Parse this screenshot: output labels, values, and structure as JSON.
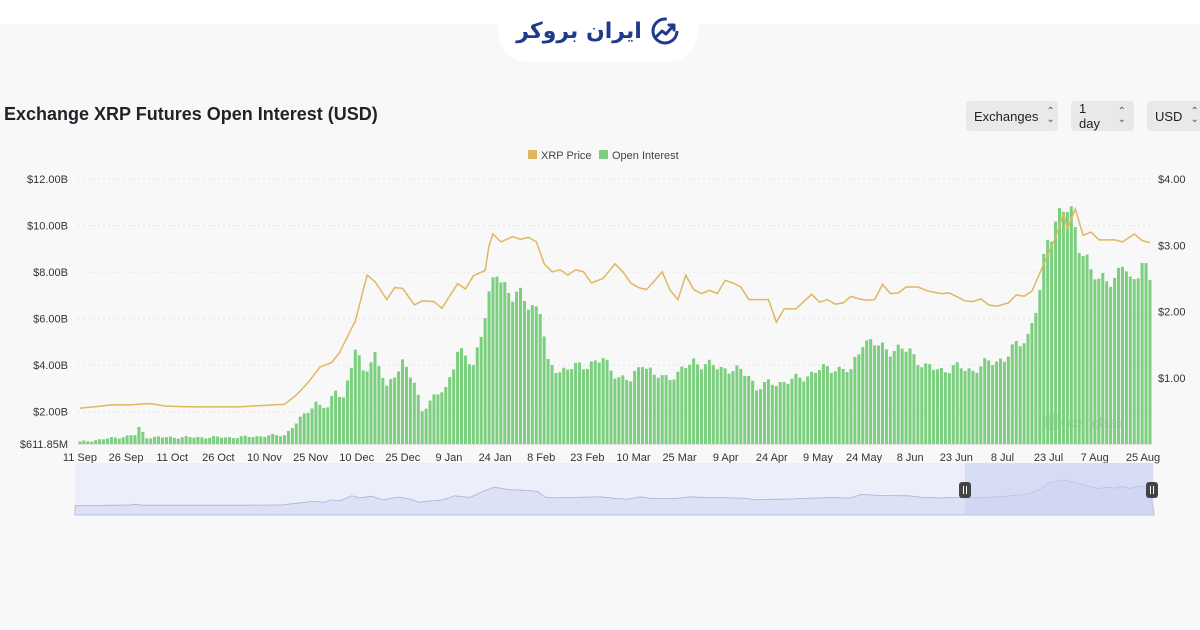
{
  "brand": {
    "name": "ایران بروکر"
  },
  "title": "Exchange XRP Futures Open Interest (USD)",
  "controls": {
    "exchanges": "Exchanges",
    "interval": "1 day",
    "currency": "USD"
  },
  "watermark": "coinglass",
  "colors": {
    "price": "#e0b760",
    "open_interest": "#7bcf7e",
    "brand": "#1f3a8a"
  },
  "chart_data": {
    "type": "bar+line",
    "title": "Exchange XRP Futures Open Interest (USD)",
    "legend": [
      "XRP Price",
      "Open Interest"
    ],
    "legend_position": "top-center",
    "grid": true,
    "x_ticks": [
      "11 Sep",
      "26 Sep",
      "11 Oct",
      "26 Oct",
      "10 Nov",
      "25 Nov",
      "10 Dec",
      "25 Dec",
      "9 Jan",
      "24 Jan",
      "8 Feb",
      "23 Feb",
      "10 Mar",
      "25 Mar",
      "9 Apr",
      "24 Apr",
      "9 May",
      "24 May",
      "8 Jun",
      "23 Jun",
      "8 Jul",
      "23 Jul",
      "7 Aug",
      "25 Aug"
    ],
    "y_left": {
      "label": "Open Interest",
      "ticks": [
        "$611.85M",
        "$2.00B",
        "$4.00B",
        "$6.00B",
        "$8.00B",
        "$10.00B",
        "$12.00B"
      ],
      "range": [
        0.61185,
        12
      ]
    },
    "y_right": {
      "label": "XRP Price",
      "ticks": [
        "$1.00",
        "$2.00",
        "$3.00",
        "$4.00"
      ],
      "range": [
        0,
        4
      ]
    },
    "open_interest_keypoints_billions": [
      [
        0,
        0.7
      ],
      [
        10,
        0.9
      ],
      [
        14,
        1.0
      ],
      [
        15,
        1.3
      ],
      [
        17,
        0.9
      ],
      [
        30,
        0.9
      ],
      [
        40,
        0.9
      ],
      [
        52,
        1.0
      ],
      [
        55,
        1.5
      ],
      [
        60,
        2.4
      ],
      [
        63,
        2.1
      ],
      [
        65,
        3.0
      ],
      [
        67,
        2.6
      ],
      [
        70,
        4.6
      ],
      [
        72,
        3.8
      ],
      [
        75,
        4.4
      ],
      [
        78,
        3.0
      ],
      [
        80,
        3.7
      ],
      [
        82,
        4.1
      ],
      [
        85,
        3.2
      ],
      [
        87,
        2.1
      ],
      [
        90,
        2.6
      ],
      [
        93,
        3.0
      ],
      [
        96,
        4.6
      ],
      [
        100,
        4.0
      ],
      [
        103,
        6.2
      ],
      [
        106,
        8.0
      ],
      [
        108,
        7.5
      ],
      [
        110,
        7.0
      ],
      [
        113,
        6.8
      ],
      [
        117,
        6.4
      ],
      [
        119,
        4.0
      ],
      [
        122,
        3.8
      ],
      [
        126,
        3.9
      ],
      [
        130,
        4.1
      ],
      [
        133,
        4.2
      ],
      [
        137,
        3.5
      ],
      [
        140,
        3.3
      ],
      [
        143,
        4.2
      ],
      [
        146,
        3.5
      ],
      [
        149,
        3.5
      ],
      [
        152,
        3.6
      ],
      [
        156,
        4.2
      ],
      [
        159,
        4.0
      ],
      [
        163,
        3.9
      ],
      [
        166,
        3.8
      ],
      [
        170,
        3.6
      ],
      [
        172,
        3.0
      ],
      [
        175,
        3.2
      ],
      [
        180,
        3.3
      ],
      [
        184,
        3.5
      ],
      [
        188,
        3.8
      ],
      [
        192,
        3.9
      ],
      [
        196,
        3.7
      ],
      [
        199,
        5.1
      ],
      [
        203,
        4.8
      ],
      [
        206,
        4.7
      ],
      [
        211,
        4.6
      ],
      [
        215,
        3.9
      ],
      [
        219,
        3.8
      ],
      [
        222,
        3.9
      ],
      [
        227,
        3.8
      ],
      [
        231,
        4.1
      ],
      [
        235,
        4.3
      ],
      [
        238,
        4.8
      ],
      [
        241,
        5.3
      ],
      [
        244,
        7.0
      ],
      [
        246,
        9.5
      ],
      [
        249,
        10.6
      ],
      [
        250,
        10.8
      ],
      [
        252,
        10.2
      ],
      [
        254,
        9.4
      ],
      [
        257,
        8.1
      ],
      [
        259,
        7.4
      ],
      [
        261,
        8.0
      ],
      [
        263,
        7.6
      ],
      [
        265,
        8.3
      ],
      [
        267,
        7.5
      ],
      [
        269,
        8.3
      ],
      [
        270,
        8.4
      ],
      [
        272,
        7.6
      ]
    ],
    "price_keypoints_usd": [
      [
        0,
        0.54
      ],
      [
        8,
        0.59
      ],
      [
        12,
        0.59
      ],
      [
        18,
        0.61
      ],
      [
        22,
        0.57
      ],
      [
        30,
        0.56
      ],
      [
        40,
        0.56
      ],
      [
        52,
        0.6
      ],
      [
        55,
        0.74
      ],
      [
        58,
        0.93
      ],
      [
        61,
        1.16
      ],
      [
        64,
        1.23
      ],
      [
        66,
        1.38
      ],
      [
        70,
        1.86
      ],
      [
        73,
        2.55
      ],
      [
        75,
        2.45
      ],
      [
        78,
        2.18
      ],
      [
        80,
        2.36
      ],
      [
        82,
        2.35
      ],
      [
        85,
        2.1
      ],
      [
        87,
        2.16
      ],
      [
        90,
        2.15
      ],
      [
        92,
        2.05
      ],
      [
        96,
        2.42
      ],
      [
        98,
        2.34
      ],
      [
        100,
        2.54
      ],
      [
        103,
        2.62
      ],
      [
        104,
        3.0
      ],
      [
        105,
        3.17
      ],
      [
        107,
        3.05
      ],
      [
        110,
        3.13
      ],
      [
        112,
        3.09
      ],
      [
        114,
        3.12
      ],
      [
        116,
        3.05
      ],
      [
        118,
        2.72
      ],
      [
        120,
        2.6
      ],
      [
        122,
        2.63
      ],
      [
        124,
        2.55
      ],
      [
        126,
        2.63
      ],
      [
        128,
        2.6
      ],
      [
        130,
        2.43
      ],
      [
        133,
        2.5
      ],
      [
        136,
        2.72
      ],
      [
        138,
        2.6
      ],
      [
        140,
        2.43
      ],
      [
        142,
        2.36
      ],
      [
        144,
        2.33
      ],
      [
        146,
        2.46
      ],
      [
        148,
        2.6
      ],
      [
        150,
        2.32
      ],
      [
        152,
        2.18
      ],
      [
        154,
        2.55
      ],
      [
        156,
        2.33
      ],
      [
        158,
        2.27
      ],
      [
        160,
        2.32
      ],
      [
        162,
        2.27
      ],
      [
        164,
        2.47
      ],
      [
        166,
        2.43
      ],
      [
        168,
        2.37
      ],
      [
        170,
        2.18
      ],
      [
        173,
        2.18
      ],
      [
        175,
        2.18
      ],
      [
        177,
        1.84
      ],
      [
        179,
        2.04
      ],
      [
        182,
        2.04
      ],
      [
        184,
        2.15
      ],
      [
        186,
        2.26
      ],
      [
        188,
        2.14
      ],
      [
        190,
        2.18
      ],
      [
        192,
        2.11
      ],
      [
        194,
        2.13
      ],
      [
        196,
        2.23
      ],
      [
        198,
        2.19
      ],
      [
        200,
        2.17
      ],
      [
        202,
        2.18
      ],
      [
        204,
        2.41
      ],
      [
        206,
        2.27
      ],
      [
        208,
        2.28
      ],
      [
        210,
        2.37
      ],
      [
        213,
        2.37
      ],
      [
        215,
        2.32
      ],
      [
        217,
        2.29
      ],
      [
        219,
        2.27
      ],
      [
        221,
        2.28
      ],
      [
        223,
        2.22
      ],
      [
        225,
        2.16
      ],
      [
        227,
        2.15
      ],
      [
        229,
        2.19
      ],
      [
        231,
        2.1
      ],
      [
        233,
        2.08
      ],
      [
        236,
        2.13
      ],
      [
        238,
        2.25
      ],
      [
        240,
        2.23
      ],
      [
        242,
        2.31
      ],
      [
        244,
        2.58
      ],
      [
        246,
        2.85
      ],
      [
        248,
        3.12
      ],
      [
        250,
        3.48
      ],
      [
        251,
        3.25
      ],
      [
        253,
        3.55
      ],
      [
        255,
        3.15
      ],
      [
        257,
        3.2
      ],
      [
        259,
        3.08
      ],
      [
        261,
        3.08
      ],
      [
        263,
        3.08
      ],
      [
        265,
        3.05
      ],
      [
        268,
        3.17
      ],
      [
        270,
        3.07
      ],
      [
        272,
        3.04
      ]
    ],
    "days": 273
  }
}
